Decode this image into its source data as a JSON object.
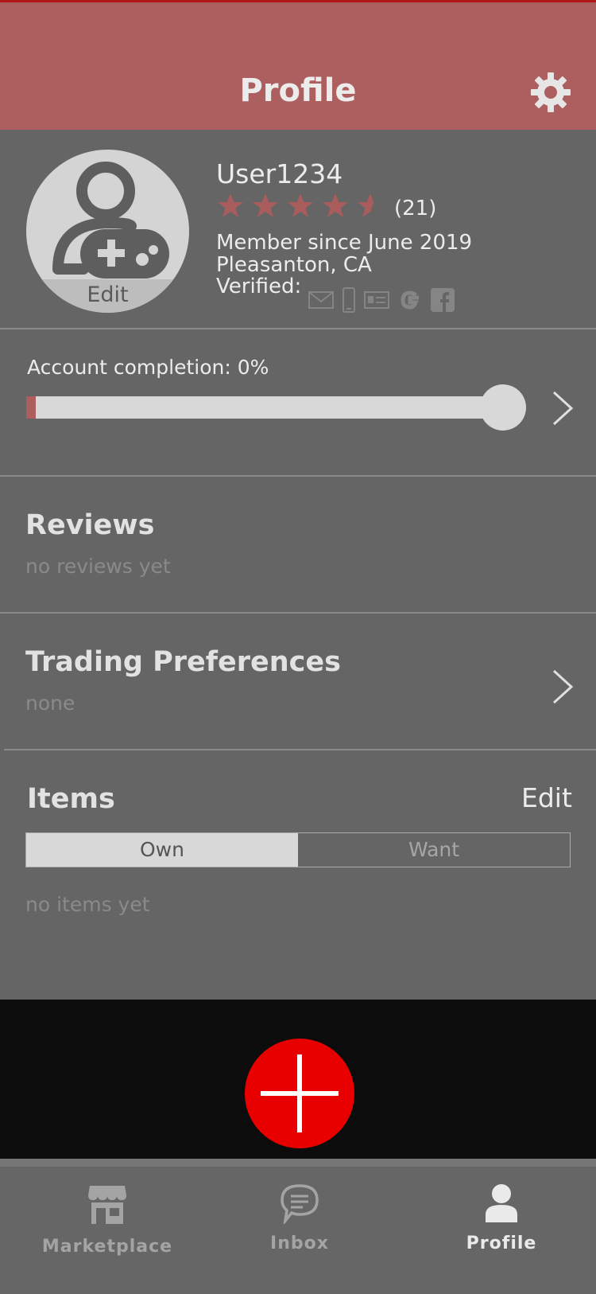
{
  "header": {
    "title": "Profile"
  },
  "profile": {
    "avatar_edit_label": "Edit",
    "username": "User1234",
    "rating": 4.5,
    "rating_max": 5,
    "rating_count": "(21)",
    "member_since": "Member since June 2019",
    "location": "Pleasanton, CA",
    "verified_label": "Verified:",
    "verified_icons": [
      "email-icon",
      "phone-icon",
      "id-card-icon",
      "google-icon",
      "facebook-icon"
    ]
  },
  "completion": {
    "label": "Account completion: 0%",
    "progress": 0.0
  },
  "reviews": {
    "title": "Reviews",
    "subtitle": "no reviews yet"
  },
  "trading": {
    "title": "Trading Preferences",
    "subtitle": "none"
  },
  "items": {
    "title": "Items",
    "edit_label": "Edit",
    "tabs": [
      {
        "label": "Own",
        "active": true
      },
      {
        "label": "Want",
        "active": false
      }
    ],
    "empty_text": "no items yet"
  },
  "bottom_nav": {
    "tabs": [
      {
        "label": "Marketplace",
        "icon": "storefront-icon",
        "active": false
      },
      {
        "label": "Inbox",
        "icon": "chat-bubble-icon",
        "active": false
      },
      {
        "label": "Profile",
        "icon": "person-icon",
        "active": true
      }
    ]
  },
  "colors": {
    "header_bg": "#ad5e5f",
    "accent": "#ad5e5f",
    "fab": "#e80000",
    "page_bg": "#656565"
  }
}
